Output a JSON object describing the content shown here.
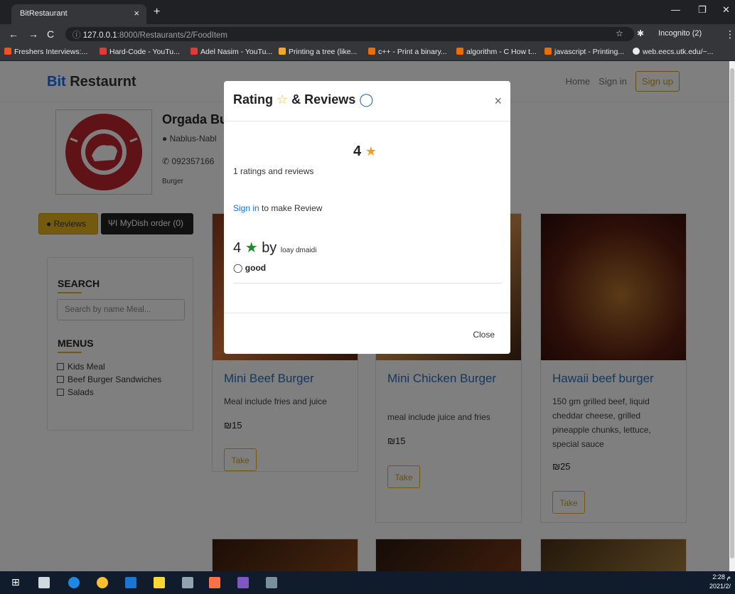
{
  "browser": {
    "tab_title": "BitRestaurant",
    "tab_close": "×",
    "new_tab": "+",
    "url_host": "127.0.0.1",
    "url_path": ":8000/Restaurants/2/FoodItem",
    "incognito": "Incognito (2)",
    "bookmarks": [
      "Freshers Interviews:...",
      "Hard-Code - YouTu...",
      "Adel Nasim - YouTu...",
      "Printing a tree (like...",
      "c++ - Print a binary...",
      "algorithm - C How t...",
      "javascript - Printing...",
      "web.eecs.utk.edu/~..."
    ]
  },
  "navbar": {
    "brand_b": "Bit",
    "brand_rest": " Restaurnt",
    "home": "Home",
    "sign_in": "Sign in",
    "sign_up": "Sign up"
  },
  "restaurant": {
    "name": "Orgada Bu",
    "location": "Nablus-Nabl",
    "phone": "092357166",
    "category": "Burger"
  },
  "buttons": {
    "reviews": "Reviews",
    "mydish": "MyDish order (0)"
  },
  "sidebar": {
    "search_title": "SEARCH",
    "search_placeholder": "Search by name Meal...",
    "menus_title": "MENUS",
    "menus": [
      "Kids Meal",
      "Beef Burger Sandwiches",
      "Salads"
    ]
  },
  "cards": [
    {
      "title": "Mini Beef Burger",
      "desc": "Meal include fries and juice",
      "price": "₪15",
      "take": "Take"
    },
    {
      "title": "Mini Chicken Burger",
      "desc": "meal include juice and fries",
      "price": "₪15",
      "take": "Take"
    },
    {
      "title": "Hawaii beef burger",
      "desc": "150 gm grilled beef, liquid cheddar cheese, grilled pineapple chunks, lettuce, special sauce",
      "price": "₪25",
      "take": "Take"
    }
  ],
  "modal": {
    "title_a": "Rating",
    "title_b": "& Reviews",
    "close_x": "×",
    "rating": "4",
    "count_text": "1 ratings and reviews",
    "signin_link": "Sign in",
    "signin_rest": " to make Review",
    "review_rating": "4",
    "review_by": "by",
    "review_user": "loay dmaidi",
    "review_comment": "good",
    "close_button": "Close"
  },
  "taskbar": {
    "time": "2:28 م",
    "date": "2021/2/"
  },
  "colors": {
    "accent_gold": "#e6b41d",
    "link_blue": "#0d6efd",
    "star_green": "#1d8a2a"
  }
}
